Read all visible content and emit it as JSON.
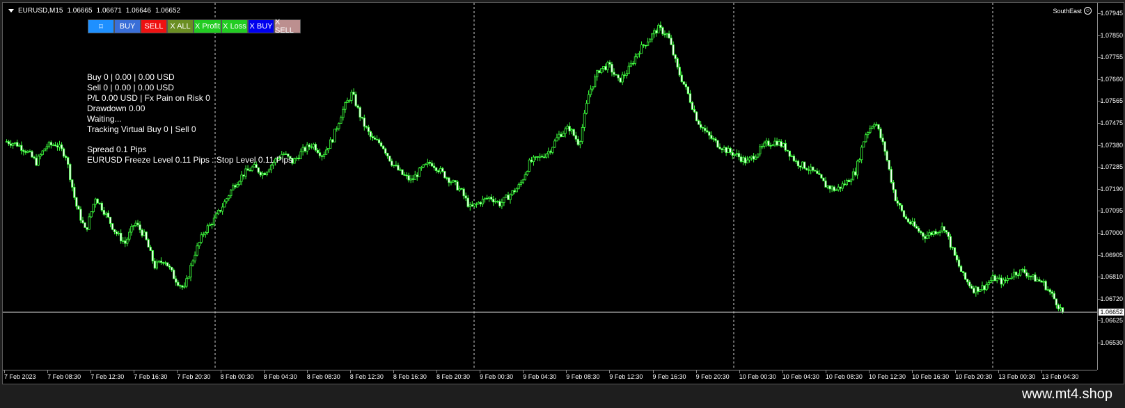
{
  "symbol_bar": {
    "symbol": "EURUSD,M15",
    "open": "1.06665",
    "high": "1.06671",
    "low": "1.06646",
    "close": "1.06652"
  },
  "corner_label": "SouthEast",
  "buttons": [
    {
      "label": "⌑",
      "color": "#1e90ff",
      "name": "chart-mode-button"
    },
    {
      "label": "BUY",
      "color": "#3a6fd8",
      "name": "buy-button"
    },
    {
      "label": "SELL",
      "color": "#ee1111",
      "name": "sell-button"
    },
    {
      "label": "X ALL",
      "color": "#6b8e23",
      "name": "close-all-button"
    },
    {
      "label": "X Profit",
      "color": "#22cc22",
      "name": "close-profit-button"
    },
    {
      "label": "X Loss",
      "color": "#22cc22",
      "name": "close-loss-button"
    },
    {
      "label": "X BUY",
      "color": "#0000ee",
      "name": "close-buy-button"
    },
    {
      "label": "X SELL",
      "color": "#bc8f8f",
      "name": "close-sell-button"
    }
  ],
  "info": {
    "buy": "Buy 0 | 0.00 | 0.00 USD",
    "sell": "Sell 0 | 0.00 | 0.00 USD",
    "pl": "P/L 0.00 USD | Fx Pain on Risk 0",
    "drawdown": "Drawdown 0.00",
    "status": "Waiting...",
    "tracking": "Tracking Virtual Buy 0 | Sell 0",
    "spread": "Spread 0.1 Pips",
    "levels": "EURUSD Freeze Level 0.11 Pips : Stop Level 0.11 Pips"
  },
  "price_axis": [
    "1.07945",
    "1.07850",
    "1.07755",
    "1.07660",
    "1.07565",
    "1.07475",
    "1.07380",
    "1.07285",
    "1.07190",
    "1.07095",
    "1.07000",
    "1.06905",
    "1.06810",
    "1.06720",
    "1.06625",
    "1.06530"
  ],
  "current_price": "1.06652",
  "time_axis": [
    "7 Feb 2023",
    "7 Feb 08:30",
    "7 Feb 12:30",
    "7 Feb 16:30",
    "7 Feb 20:30",
    "8 Feb 00:30",
    "8 Feb 04:30",
    "8 Feb 08:30",
    "8 Feb 12:30",
    "8 Feb 16:30",
    "8 Feb 20:30",
    "9 Feb 00:30",
    "9 Feb 04:30",
    "9 Feb 08:30",
    "9 Feb 12:30",
    "9 Feb 16:30",
    "9 Feb 20:30",
    "10 Feb 00:30",
    "10 Feb 04:30",
    "10 Feb 08:30",
    "10 Feb 12:30",
    "10 Feb 16:30",
    "10 Feb 20:30",
    "13 Feb 00:30",
    "13 Feb 04:30"
  ],
  "chart_data": {
    "type": "line",
    "series": [
      {
        "values": [
          1.0739,
          1.0738,
          1.0735,
          1.073,
          1.0737,
          1.0738,
          1.0733,
          1.0712,
          1.07,
          1.0715,
          1.0708,
          1.07,
          1.0695,
          1.0704,
          1.0698,
          1.0685,
          1.0688,
          1.068,
          1.0675,
          1.069,
          1.07,
          1.0705,
          1.0712,
          1.072,
          1.0725,
          1.0728,
          1.0725,
          1.073,
          1.0734,
          1.073,
          1.0735,
          1.0738,
          1.0733,
          1.074,
          1.0752,
          1.076,
          1.0748,
          1.074,
          1.0738,
          1.073,
          1.0725,
          1.0722,
          1.0727,
          1.073,
          1.0726,
          1.0722,
          1.0718,
          1.071,
          1.0713,
          1.0715,
          1.0712,
          1.0716,
          1.072,
          1.073,
          1.0732,
          1.0735,
          1.0742,
          1.0745,
          1.0738,
          1.076,
          1.077,
          1.0772,
          1.0765,
          1.077,
          1.0778,
          1.0783,
          1.0788,
          1.0785,
          1.077,
          1.076,
          1.0748,
          1.0742,
          1.0738,
          1.0735,
          1.0733,
          1.073,
          1.0734,
          1.0738,
          1.0739,
          1.0736,
          1.073,
          1.0728,
          1.0725,
          1.072,
          1.0718,
          1.0721,
          1.0726,
          1.0742,
          1.0748,
          1.0735,
          1.0715,
          1.0706,
          1.0702,
          1.0698,
          1.07,
          1.0702,
          1.069,
          1.068,
          1.0675,
          1.0676,
          1.068,
          1.0678,
          1.0682,
          1.0683,
          1.068,
          1.0678,
          1.0672,
          1.0665
        ]
      }
    ],
    "ylim": [
      1.065,
      1.0797
    ]
  }
}
